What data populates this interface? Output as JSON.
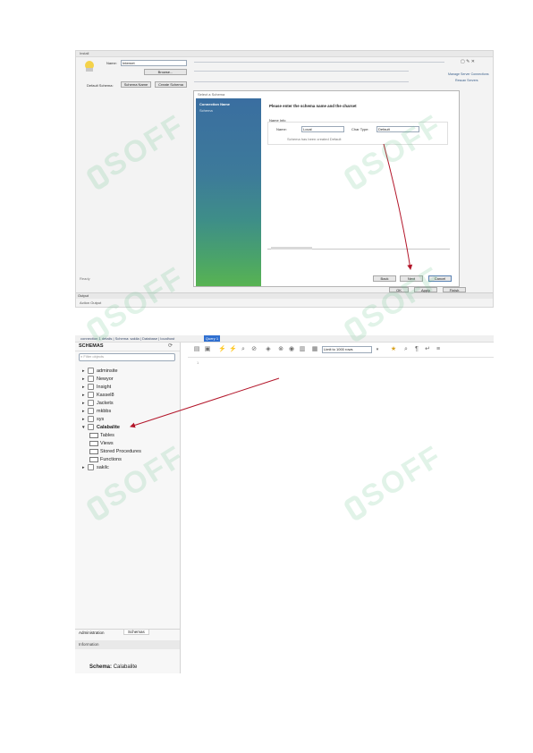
{
  "top_screenshot": {
    "window_title": "Install",
    "name_label": "Name:",
    "name_value": "Internet",
    "browse_button": "Browse...",
    "schemas_label": "Default Schema:",
    "schema_button_1": "Schema Name",
    "schema_button_2": "Create Schema",
    "side_link_1": "Manage Server Connections",
    "side_link_2": "Rescan Servers",
    "status_text": "Ready",
    "dialog": {
      "title": "Select a Schema",
      "wizard_steps": [
        "Connection Name",
        "Schema"
      ],
      "heading": "Please enter the schema name and the charset",
      "group_label": "Name Info",
      "schema_label": "Name:",
      "schema_value": "Local",
      "collation_label": "Char Type:",
      "collation_value": "Default",
      "hint_text": "Schema has been created   Default",
      "back_button": "Back",
      "next_button": "Next",
      "cancel_button": "Cancel",
      "ok_button": "OK",
      "apply_button": "Apply",
      "finish_button": "Finish"
    },
    "bottom_bar_left": "Output",
    "bottom_bar_right": "Action Output"
  },
  "bottom_screenshot": {
    "breadcrumb": "connection 1 details | Schema: sakila | Database | localhost",
    "breadcrumb_tab": "Query 1",
    "sidebar_title": "SCHEMAS",
    "filter_placeholder": "Filter objects",
    "schemas": [
      "adminsite",
      "Newyor",
      "Insight",
      "Kassel8",
      "Jackets",
      "mkbbs",
      "sys",
      "Calabalite",
      "sakilc"
    ],
    "expanded_schema_children": [
      "Tables",
      "Views",
      "Stored Procedures",
      "Functions"
    ],
    "tab_admin": "Administration",
    "tab_schemas": "Schemas",
    "info_header": "Information",
    "schema_info_label": "Schema:",
    "schema_info_value": "Calabalite",
    "limit_label": "Limit to 1000 rows",
    "editor_line": "1"
  },
  "watermark_text": "SOFF",
  "accent_color": "#b3162a"
}
